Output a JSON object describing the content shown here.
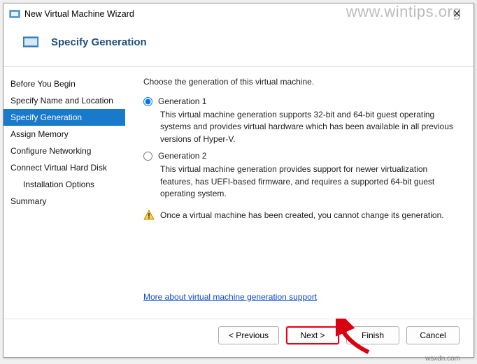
{
  "window": {
    "title": "New Virtual Machine Wizard"
  },
  "header": {
    "title": "Specify Generation"
  },
  "sidebar": {
    "steps": [
      {
        "label": "Before You Begin"
      },
      {
        "label": "Specify Name and Location"
      },
      {
        "label": "Specify Generation"
      },
      {
        "label": "Assign Memory"
      },
      {
        "label": "Configure Networking"
      },
      {
        "label": "Connect Virtual Hard Disk"
      },
      {
        "label": "Installation Options"
      },
      {
        "label": "Summary"
      }
    ]
  },
  "content": {
    "prompt": "Choose the generation of this virtual machine.",
    "option1": {
      "label": "Generation 1",
      "desc": "This virtual machine generation supports 32-bit and 64-bit guest operating systems and provides virtual hardware which has been available in all previous versions of Hyper-V."
    },
    "option2": {
      "label": "Generation 2",
      "desc": "This virtual machine generation provides support for newer virtualization features, has UEFI-based firmware, and requires a supported 64-bit guest operating system."
    },
    "warning": "Once a virtual machine has been created, you cannot change its generation.",
    "link": "More about virtual machine generation support"
  },
  "footer": {
    "previous": "< Previous",
    "next": "Next >",
    "finish": "Finish",
    "cancel": "Cancel"
  },
  "watermark": "www.wintips.org",
  "watermark2": "wsxdn.com"
}
